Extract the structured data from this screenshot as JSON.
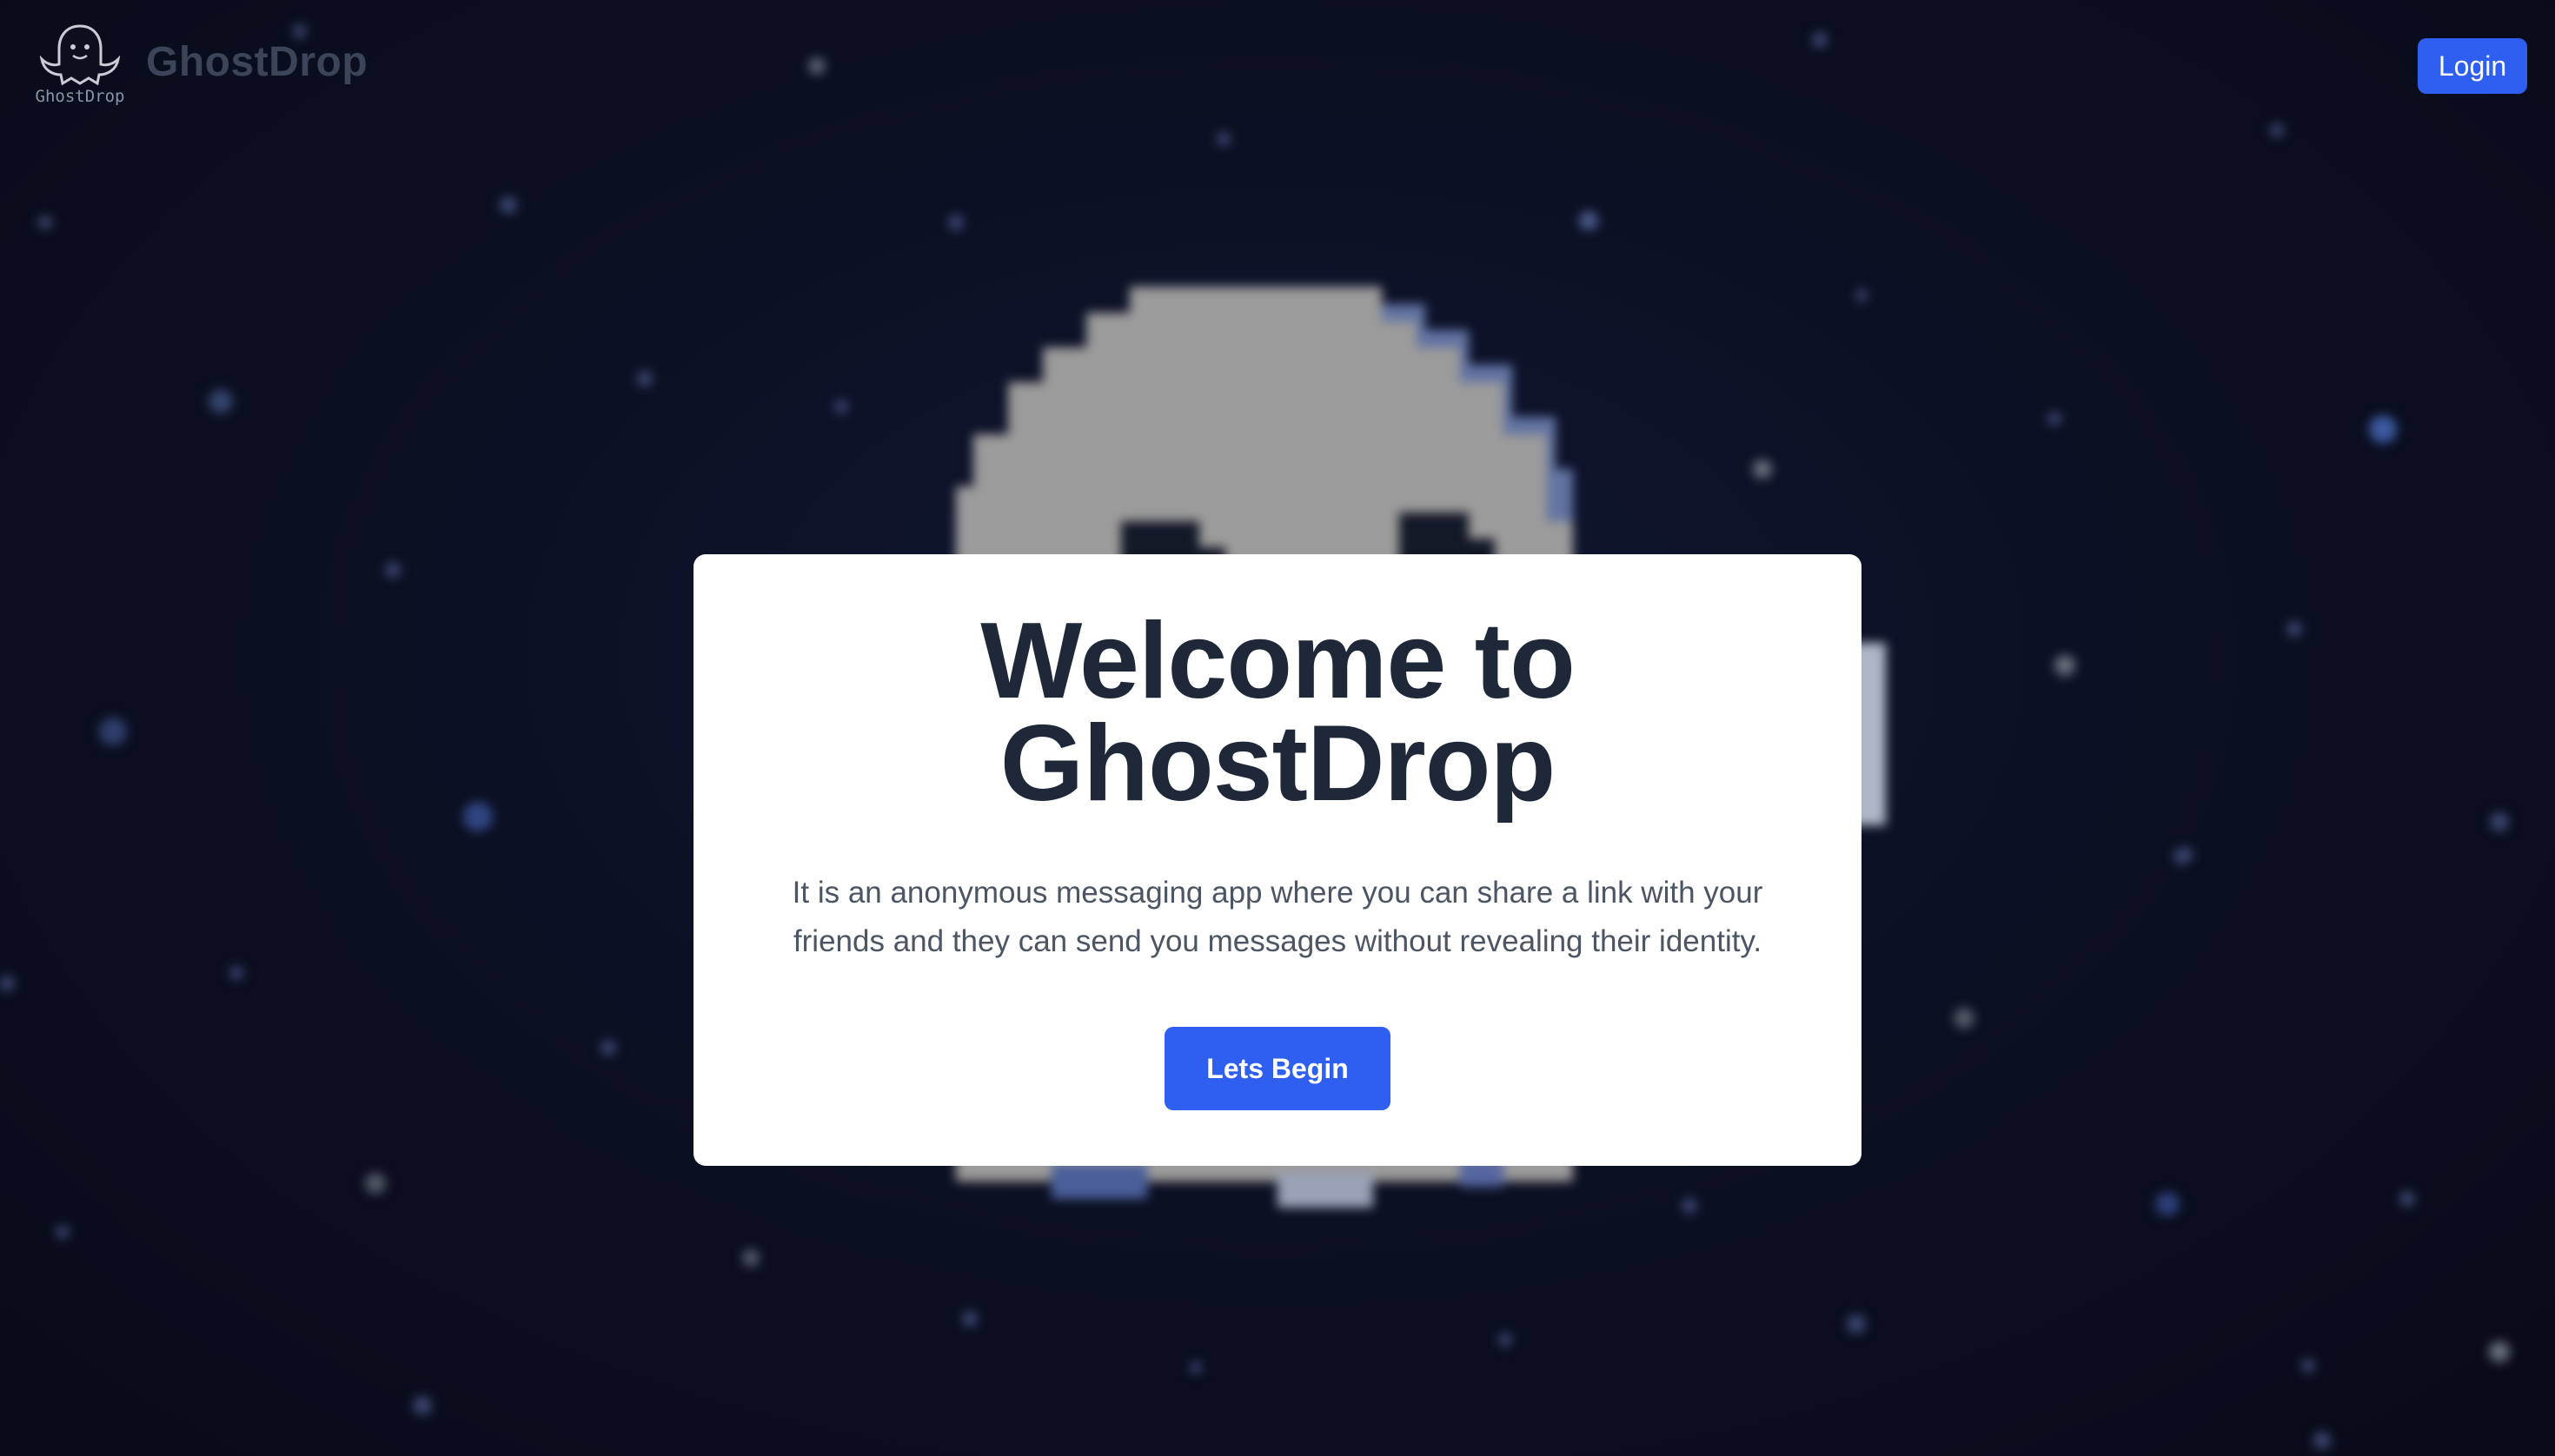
{
  "nav": {
    "logo_caption": "GhostDrop",
    "brand": "GhostDrop",
    "login_label": "Login"
  },
  "hero": {
    "title_line1": "Welcome to",
    "title_line2": "GhostDrop",
    "description": "It is an anonymous messaging app where you can share a link with your friends and they can send you messages without revealing their identity.",
    "cta_label": "Lets Begin"
  },
  "colors": {
    "background": "#0b0f1e",
    "accent": "#2f5ff0",
    "card": "#ffffff",
    "title": "#1f2838",
    "body_text": "#4b5563"
  },
  "icons": {
    "logo": "ghost-icon",
    "background_art": "pixel-ghost-illustration"
  }
}
